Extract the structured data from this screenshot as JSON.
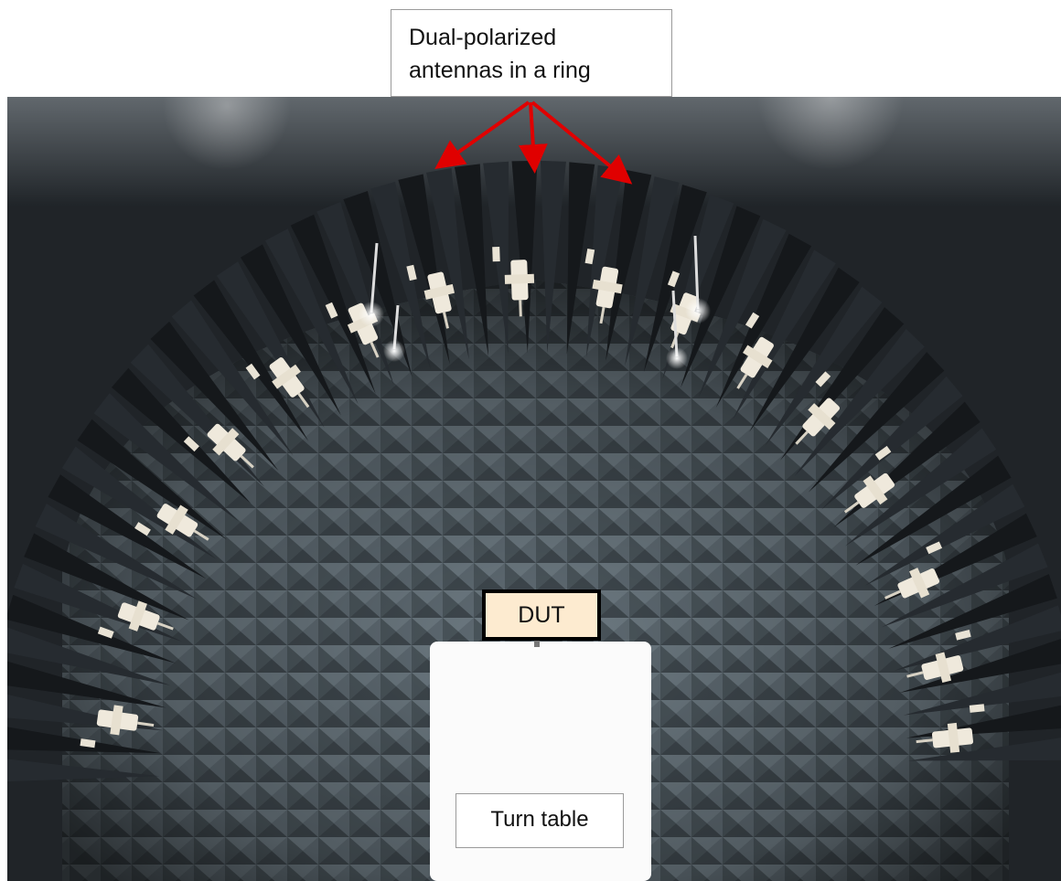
{
  "callouts": {
    "ring_line1": "Dual-polarized",
    "ring_line2": "antennas in a ring",
    "dut": "DUT",
    "turn_table": "Turn table"
  },
  "colors": {
    "arrow": "#e00000",
    "absorber": "#5b666d",
    "wall": "#1e2226",
    "dut_fill": "#fdebd0",
    "turntable": "#ffffff"
  }
}
